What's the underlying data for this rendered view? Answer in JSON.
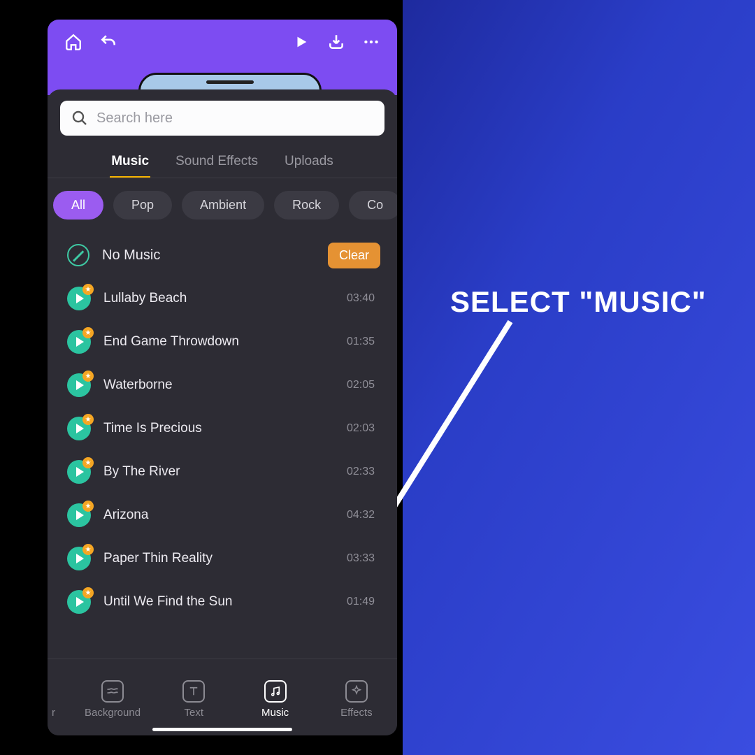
{
  "callout": "SELECT \"MUSIC\"",
  "search": {
    "placeholder": "Search here"
  },
  "tabs": [
    "Music",
    "Sound Effects",
    "Uploads"
  ],
  "active_tab": 0,
  "chips": [
    "All",
    "Pop",
    "Ambient",
    "Rock",
    "Co"
  ],
  "active_chip": 0,
  "no_music": {
    "label": "No Music",
    "clear": "Clear"
  },
  "tracks": [
    {
      "title": "Lullaby Beach",
      "duration": "03:40"
    },
    {
      "title": "End Game Throwdown",
      "duration": "01:35"
    },
    {
      "title": "Waterborne",
      "duration": "02:05"
    },
    {
      "title": "Time Is Precious",
      "duration": "02:03"
    },
    {
      "title": "By The River",
      "duration": "02:33"
    },
    {
      "title": "Arizona",
      "duration": "04:32"
    },
    {
      "title": "Paper Thin Reality",
      "duration": "03:33"
    },
    {
      "title": "Until We Find the Sun",
      "duration": "01:49"
    }
  ],
  "bottom_nav": {
    "edge": "r",
    "items": [
      {
        "label": "Background"
      },
      {
        "label": "Text"
      },
      {
        "label": "Music"
      },
      {
        "label": "Effects"
      }
    ],
    "active": 2
  }
}
